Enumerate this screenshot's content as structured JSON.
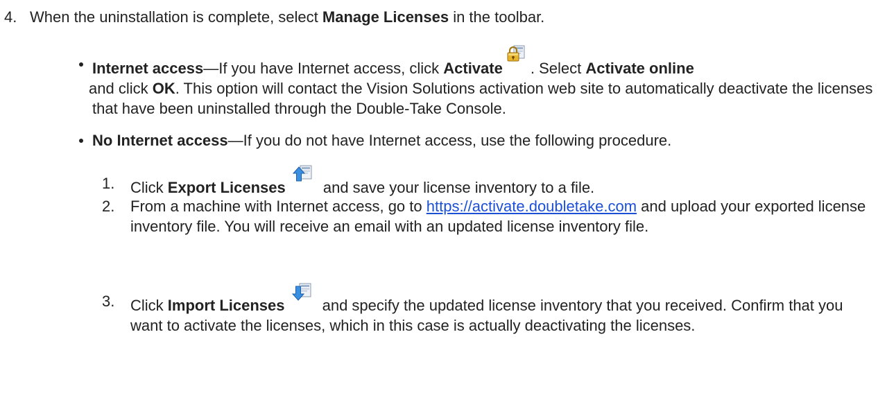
{
  "step4": {
    "number": "4.",
    "text_before": "When the uninstallation is complete, select ",
    "bold": "Manage Licenses",
    "text_after": " in the toolbar."
  },
  "bullet_internet": {
    "title": "Internet access",
    "dash_text": "—If you have Internet access, click ",
    "activate_label": "Activate",
    "activate_icon": "activate-lock-icon",
    "select_text": ". Select ",
    "activate_online": "Activate online",
    "and_click": " and click ",
    "ok": "OK",
    "rest": ". This option will contact the Vision Solutions activation web site to automatically deactivate the licenses that have been uninstalled through the Double-Take Console."
  },
  "bullet_no_internet": {
    "title": "No Internet access",
    "text": "—If you do not have Internet access, use the following procedure."
  },
  "procedure": {
    "step1": {
      "number": "1.",
      "click": "Click ",
      "label": "Export Licenses",
      "icon": "export-licenses-icon",
      "rest": " and save your license inventory to a file."
    },
    "step2": {
      "number": "2.",
      "before": "From a machine with Internet access, go to ",
      "link": "https://activate.doubletake.com",
      "after": " and upload your exported license inventory file. You will receive an email with an updated license inventory file."
    },
    "step3": {
      "number": "3.",
      "click": "Click ",
      "label": "Import Licenses",
      "icon": "import-licenses-icon",
      "rest": " and specify the updated license inventory that you received. Confirm that you want to activate the licenses, which in this case is actually deactivating the licenses."
    }
  }
}
